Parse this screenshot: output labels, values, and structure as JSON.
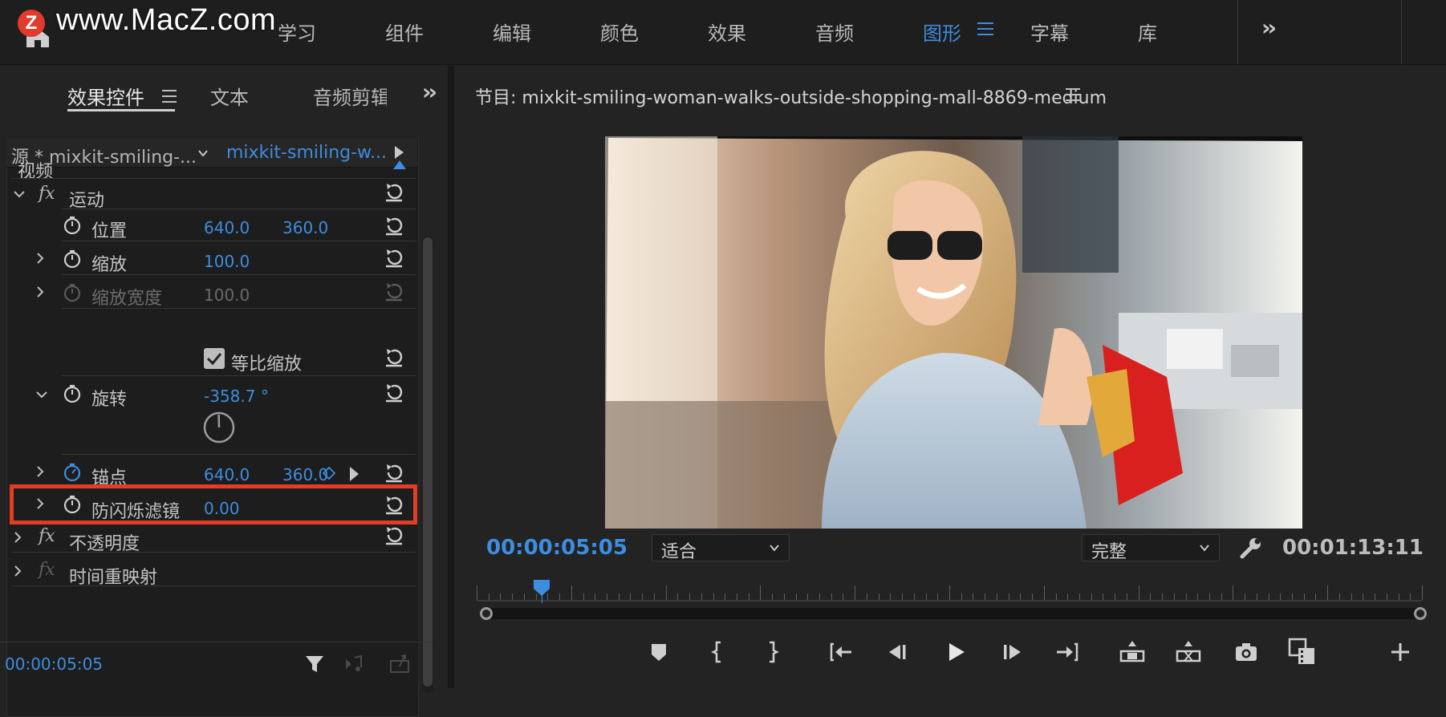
{
  "watermark": {
    "badge": "Z",
    "text": "www.MacZ.com"
  },
  "workspaces": {
    "tabs": [
      "学习",
      "组件",
      "编辑",
      "颜色",
      "效果",
      "音频",
      "图形",
      "字幕",
      "库"
    ],
    "active": "图形"
  },
  "left_panel": {
    "tabs": [
      "效果控件",
      "文本",
      "音频剪辑"
    ],
    "active_tab": "效果控件",
    "source_label": "源 * mixkit-smiling-...",
    "clip_label": "mixkit-smiling-w...",
    "section": "视频",
    "rows": {
      "motion": "运动",
      "position": {
        "label": "位置",
        "x": "640.0",
        "y": "360.0"
      },
      "scale": {
        "label": "缩放",
        "value": "100.0"
      },
      "scale_width": {
        "label": "缩放宽度",
        "value": "100.0"
      },
      "uniform_scale": {
        "label": "等比缩放",
        "checked": true
      },
      "rotation": {
        "label": "旋转",
        "value": "-358.7 °"
      },
      "anchor": {
        "label": "锚点",
        "x": "640.0",
        "y": "360.0"
      },
      "antiflicker": {
        "label": "防闪烁滤镜",
        "value": "0.00"
      },
      "opacity": "不透明度",
      "time_remap": "时间重映射"
    },
    "fx_label": "fx",
    "timecode": "00:00:05:05"
  },
  "monitor": {
    "title": "节目: mixkit-smiling-woman-walks-outside-shopping-mall-8869-medium",
    "timecode_current": "00:00:05:05",
    "zoom": "适合",
    "quality": "完整",
    "timecode_duration": "00:01:13:11"
  },
  "colors": {
    "accent": "#3d8de0",
    "highlight": "#e43d25",
    "panel_bg": "#232323"
  }
}
